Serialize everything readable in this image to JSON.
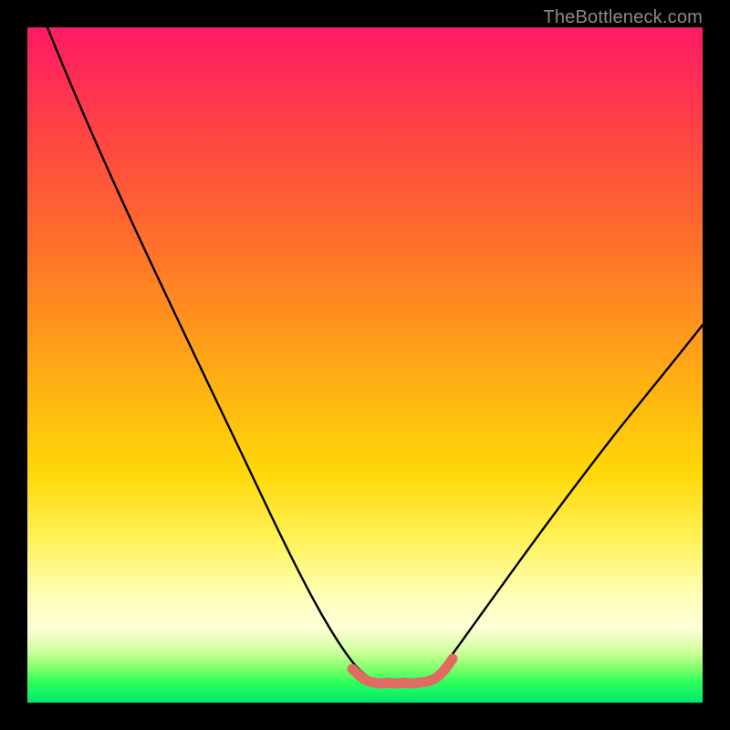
{
  "watermark": "TheBottleneck.com",
  "chart_data": {
    "type": "line",
    "title": "",
    "xlabel": "",
    "ylabel": "",
    "xlim": [
      0,
      100
    ],
    "ylim": [
      0,
      100
    ],
    "series": [
      {
        "name": "bottleneck-curve",
        "x": [
          3,
          10,
          20,
          30,
          40,
          46,
          49,
          52,
          55,
          58,
          60,
          65,
          75,
          90,
          100
        ],
        "y": [
          100,
          81,
          59,
          40,
          22,
          10,
          5,
          3,
          3,
          5,
          8,
          15,
          28,
          47,
          60
        ]
      }
    ],
    "highlight_range_x": [
      49,
      58
    ],
    "colors": {
      "curve": "#000000",
      "highlight": "#e16a63",
      "gradient_top": "#ff1a63",
      "gradient_bottom": "#00e86f"
    }
  }
}
